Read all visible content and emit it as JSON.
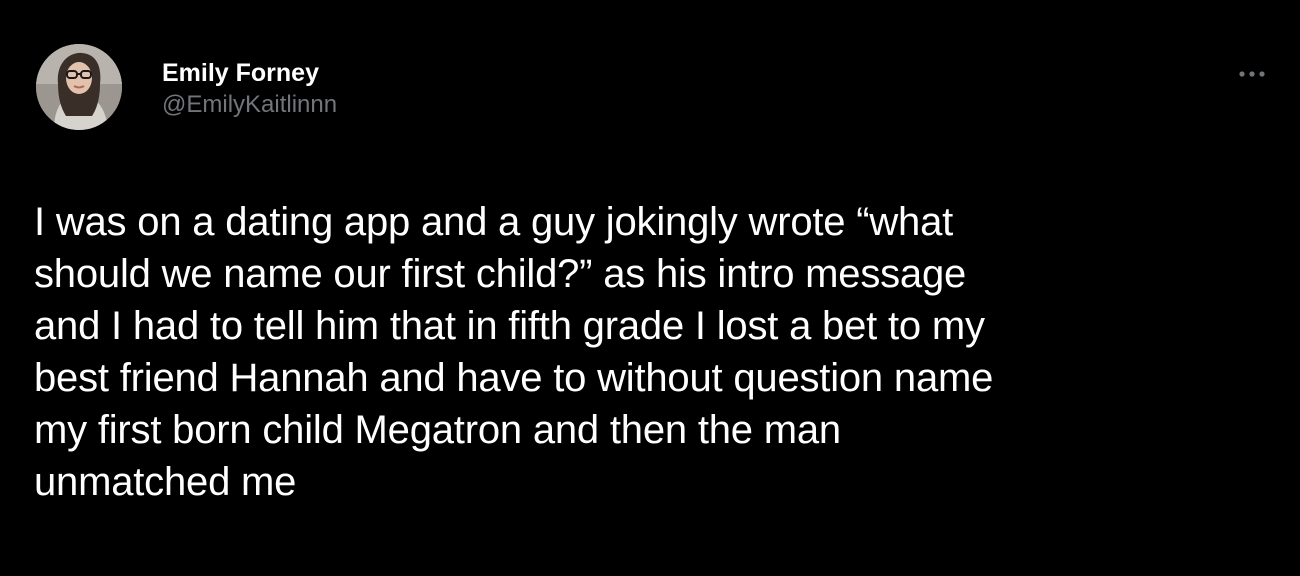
{
  "tweet": {
    "author": {
      "display_name": "Emily Forney",
      "handle": "@EmilyKaitlinnn",
      "avatar": "profile-photo"
    },
    "more_icon": "ellipsis-icon",
    "text": "I was on a dating app and a guy jokingly wrote “what\nshould we name our first child?” as his intro message\nand I had to tell him that in fifth grade I lost a bet to my\nbest friend Hannah and have to without question name\nmy first born child Megatron and then the man\nunmatched me"
  },
  "colors": {
    "background": "#000000",
    "primary_text": "#ffffff",
    "secondary_text": "#71767b"
  }
}
